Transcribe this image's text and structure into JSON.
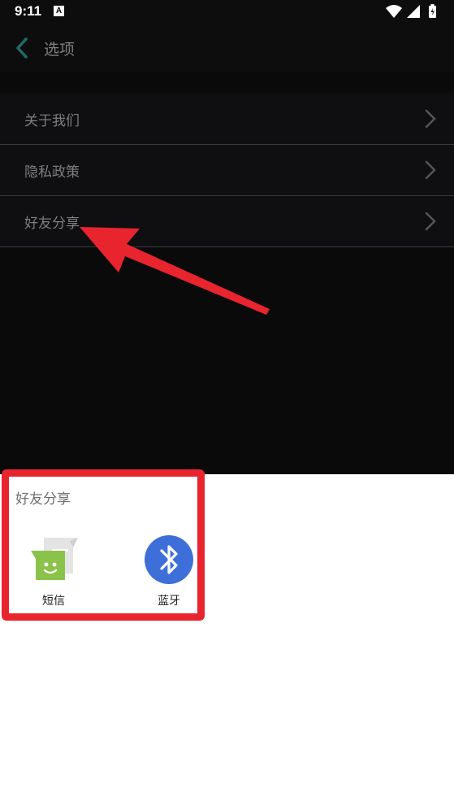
{
  "status_bar": {
    "time": "9:11",
    "notification_icon_letter": "A",
    "icons": [
      "wifi-icon",
      "signal-icon",
      "battery-icon"
    ]
  },
  "app_bar": {
    "title": "选项",
    "back_icon": "back-arrow-icon",
    "accent_color": "#1f6b66"
  },
  "menu": {
    "items": [
      {
        "label": "关于我们",
        "icon": "chevron-right-icon"
      },
      {
        "label": "隐私政策",
        "icon": "chevron-right-icon"
      },
      {
        "label": "好友分享",
        "icon": "chevron-right-icon"
      }
    ]
  },
  "share_sheet": {
    "title": "好友分享",
    "options": [
      {
        "label": "短信",
        "icon": "sms-messages-icon",
        "color": "#8bc34a"
      },
      {
        "label": "蓝牙",
        "icon": "bluetooth-icon",
        "color": "#3e6fd8"
      }
    ]
  },
  "annotations": {
    "highlight_color": "#e8242f",
    "arrow_color": "#e8242f"
  }
}
